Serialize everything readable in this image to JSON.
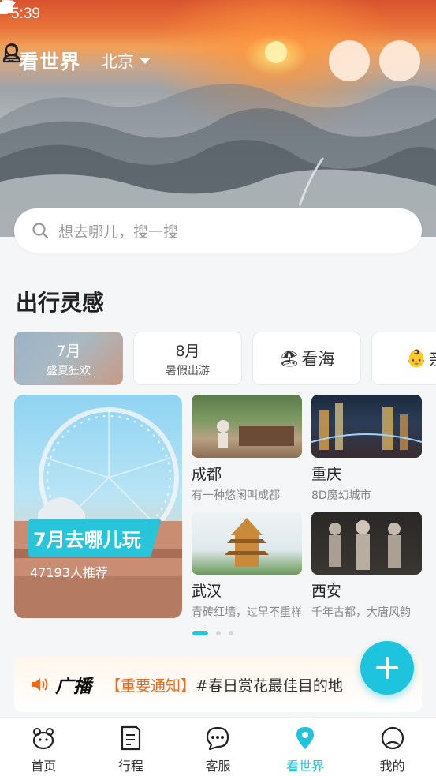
{
  "status_bar": {
    "time": "5:39"
  },
  "header": {
    "brand": "看世界",
    "city": "北京"
  },
  "search": {
    "placeholder": "想去哪儿，搜一搜"
  },
  "inspiration": {
    "title": "出行灵感",
    "tabs": [
      {
        "big": "7月",
        "small": "盛夏狂欢",
        "active": true
      },
      {
        "big": "8月",
        "small": "暑假出游"
      },
      {
        "label": "看海",
        "emoji": "🏖"
      },
      {
        "label": "亲",
        "emoji": "👶"
      }
    ],
    "feature": {
      "title": "7月去哪儿玩",
      "subtitle": "47193人推荐"
    },
    "cards": [
      {
        "name": "成都",
        "desc": "有一种悠闲叫成都"
      },
      {
        "name": "重庆",
        "desc": "8D魔幻城市"
      },
      {
        "name": "武汉",
        "desc": "青砖红墙，过早不重样"
      },
      {
        "name": "西安",
        "desc": "千年古都，大唐风韵"
      }
    ]
  },
  "broadcast": {
    "label": "广播",
    "notice": "【重要通知】",
    "message": "#春日赏花最佳目的地"
  },
  "bottom_nav": [
    {
      "label": "首页",
      "icon": "home-face-icon"
    },
    {
      "label": "行程",
      "icon": "itinerary-icon"
    },
    {
      "label": "客服",
      "icon": "chat-icon"
    },
    {
      "label": "看世界",
      "icon": "location-pin-icon",
      "active": true
    },
    {
      "label": "我的",
      "icon": "profile-icon"
    }
  ],
  "colors": {
    "accent": "#1ec4de",
    "notice": "#f06a1a"
  }
}
